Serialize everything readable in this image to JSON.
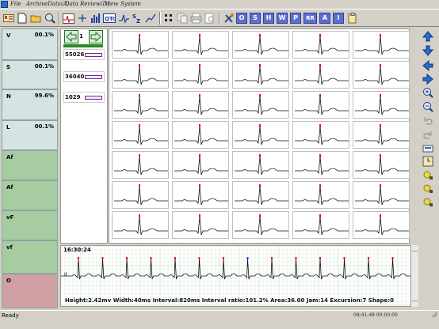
{
  "menu": [
    "File",
    "ArchiveData(A)",
    "Data Review(D)",
    "View",
    "System"
  ],
  "toolbar": {
    "letters": [
      "O",
      "S",
      "H",
      "W",
      "P",
      "RR",
      "A",
      "I"
    ]
  },
  "classes": [
    {
      "name": "V",
      "pct": "00.1%"
    },
    {
      "name": "S",
      "pct": "00.1%"
    },
    {
      "name": "N",
      "pct": "99.6%"
    },
    {
      "name": "L",
      "pct": "00.1%"
    },
    {
      "name": "Af",
      "pct": ""
    },
    {
      "name": "Af",
      "pct": ""
    },
    {
      "name": "vF",
      "pct": ""
    },
    {
      "name": "vf",
      "pct": ""
    },
    {
      "name": "O",
      "pct": ""
    }
  ],
  "template": {
    "page": "1",
    "items": [
      "55026",
      "36040",
      "1029"
    ]
  },
  "strip": {
    "time": "16:30:24",
    "lead": "II",
    "info": "Height:2.42mv Width:40ms Interval:820ms Interval ratio:101.2% Area:36.00 Jam:14 Excursion:7 Shape:0"
  },
  "status": {
    "text": "Ready",
    "datetime": "08:41:48 00:00:00"
  }
}
